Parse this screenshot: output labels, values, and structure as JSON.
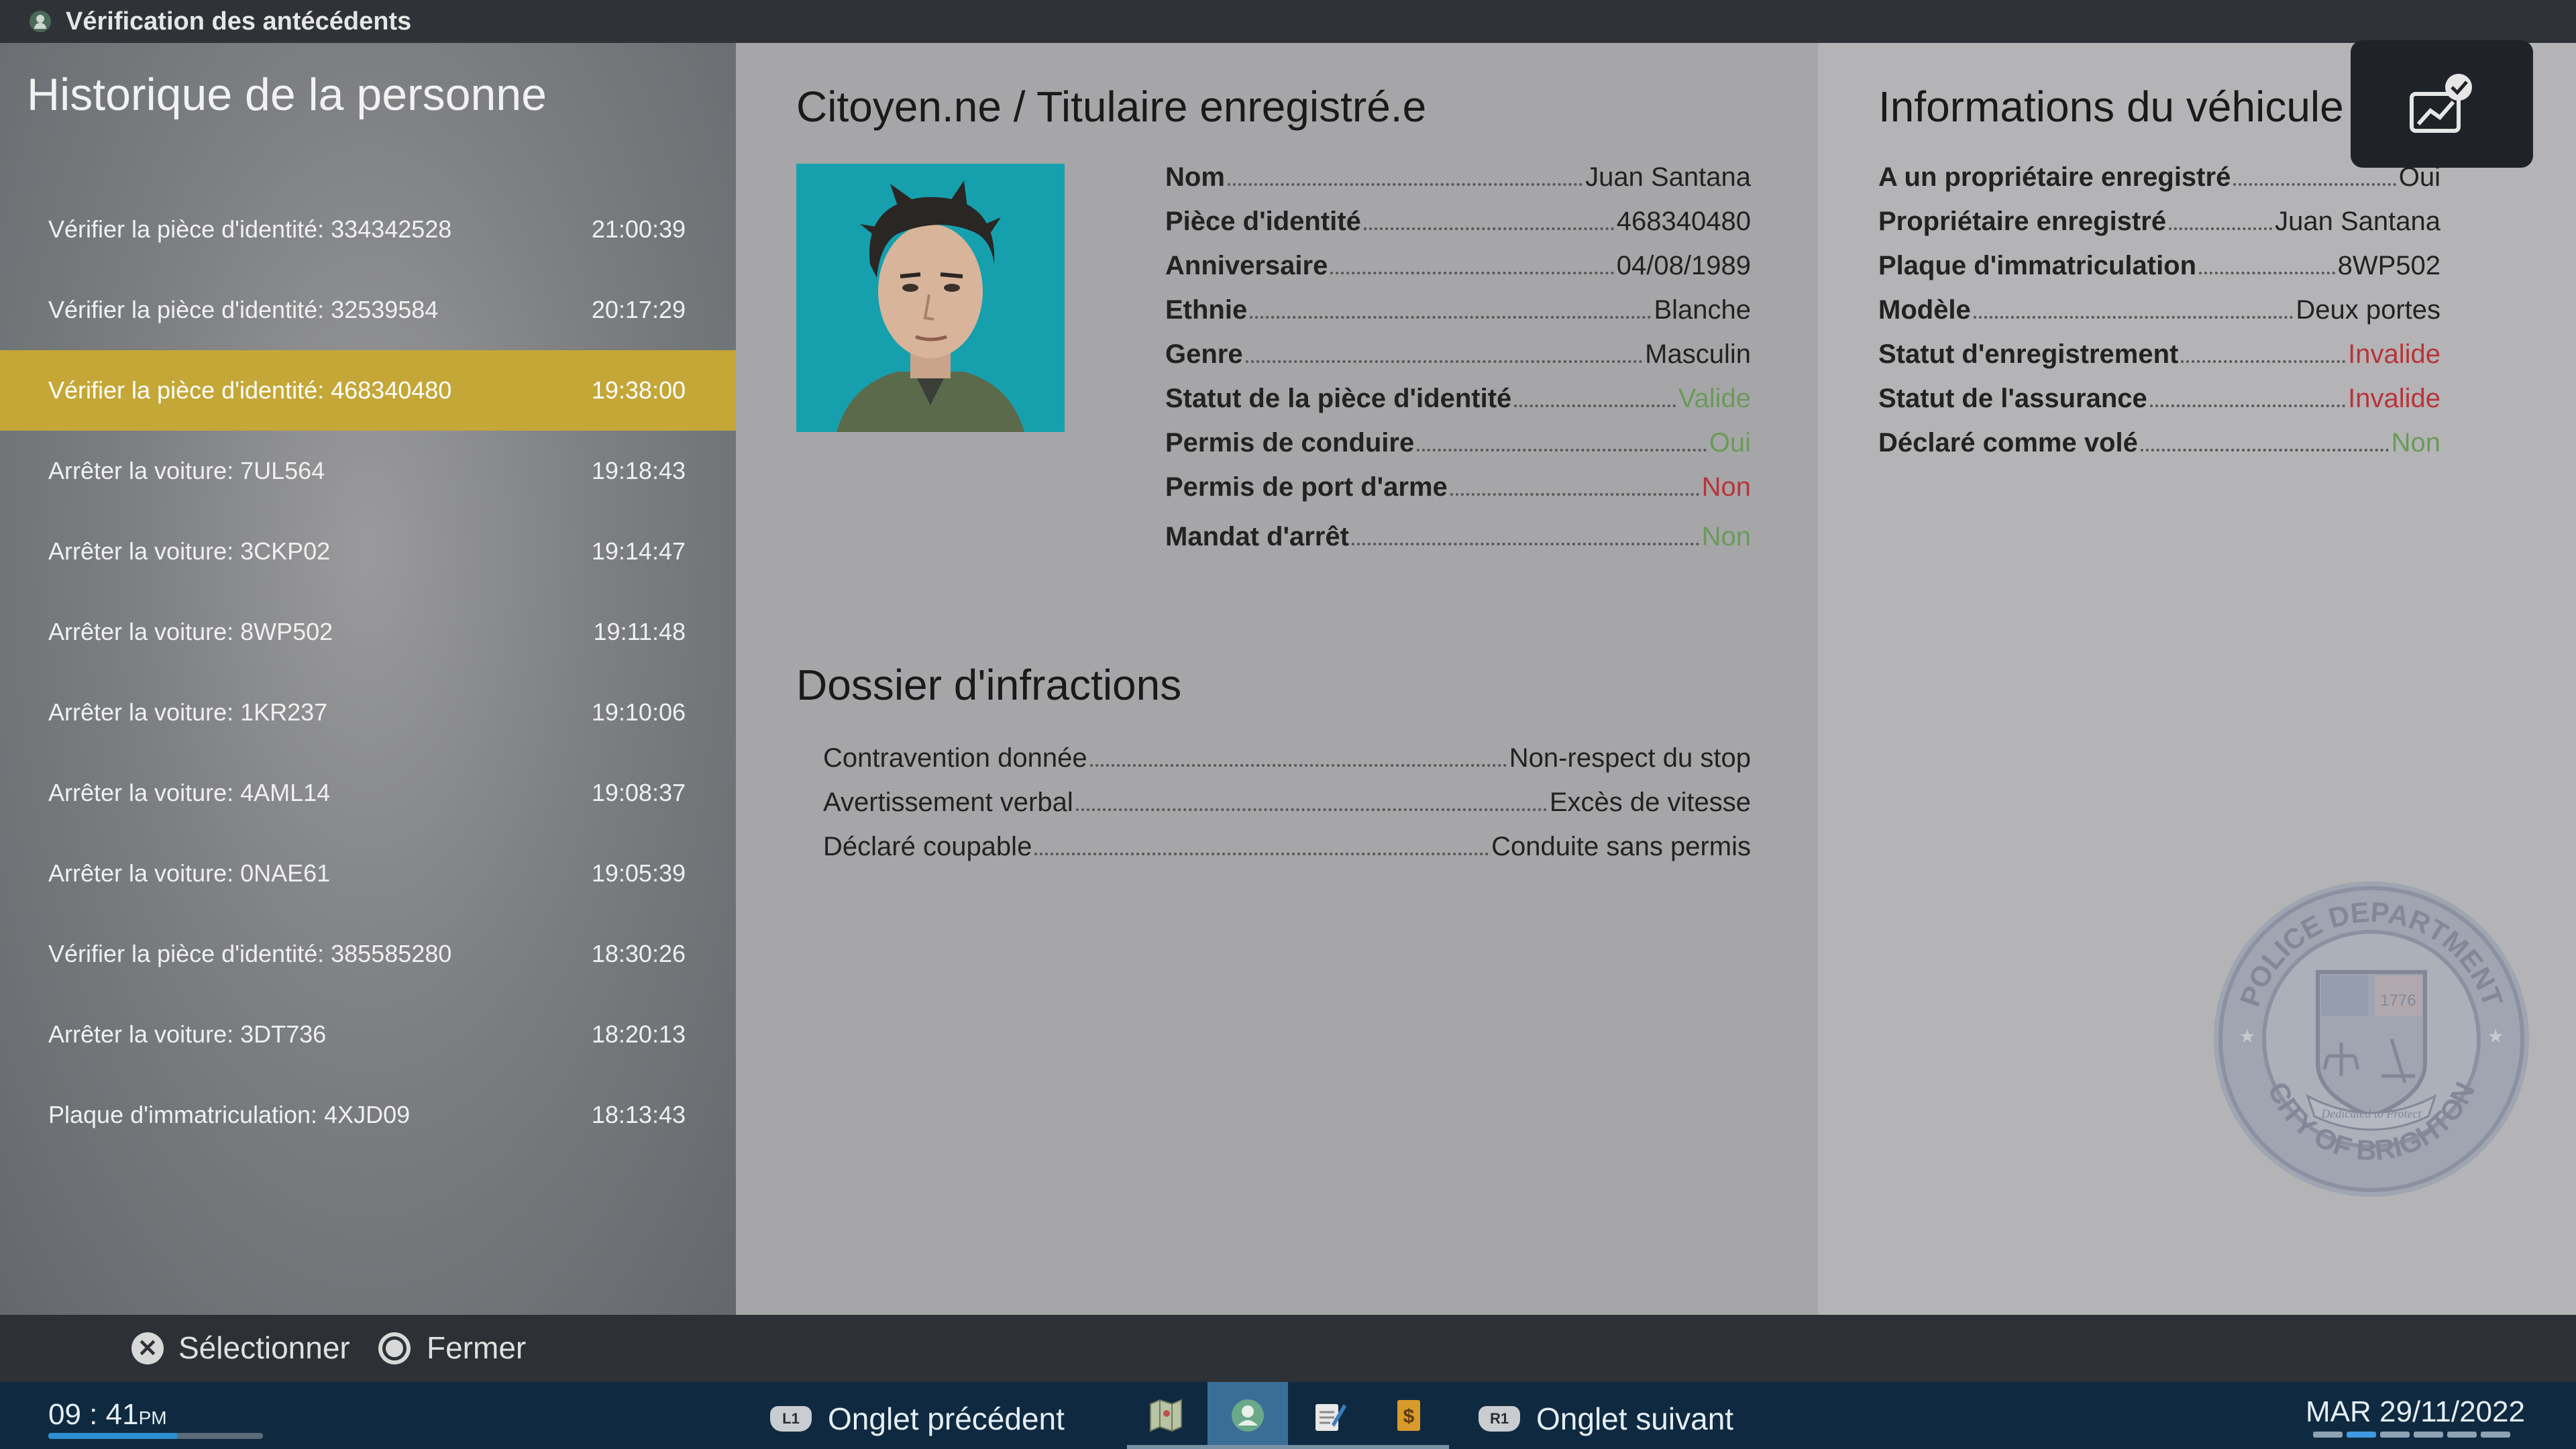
{
  "titlebar": {
    "title": "Vérification des antécédents",
    "icon": "person-check-icon"
  },
  "history": {
    "title": "Historique de la personne",
    "items": [
      {
        "label": "Vérifier la pièce d'identité: 334342528",
        "time": "21:00:39"
      },
      {
        "label": "Vérifier la pièce d'identité: 32539584",
        "time": "20:17:29"
      },
      {
        "label": "Vérifier la pièce d'identité: 468340480",
        "time": "19:38:00"
      },
      {
        "label": "Arrêter la voiture: 7UL564",
        "time": "19:18:43"
      },
      {
        "label": "Arrêter la voiture: 3CKP02",
        "time": "19:14:47"
      },
      {
        "label": "Arrêter la voiture: 8WP502",
        "time": "19:11:48"
      },
      {
        "label": "Arrêter la voiture: 1KR237",
        "time": "19:10:06"
      },
      {
        "label": "Arrêter la voiture: 4AML14",
        "time": "19:08:37"
      },
      {
        "label": "Arrêter la voiture: 0NAE61",
        "time": "19:05:39"
      },
      {
        "label": "Vérifier la pièce d'identité: 385585280",
        "time": "18:30:26"
      },
      {
        "label": "Arrêter la voiture: 3DT736",
        "time": "18:20:13"
      },
      {
        "label": "Plaque d'immatriculation: 4XJD09",
        "time": "18:13:43"
      }
    ],
    "selected_index": 2
  },
  "citizen": {
    "title": "Citoyen.ne / Titulaire enregistré.e",
    "fields": [
      {
        "label": "Nom",
        "value": "Juan Santana",
        "status": "normal"
      },
      {
        "label": "Pièce d'identité",
        "value": "468340480",
        "status": "normal"
      },
      {
        "label": "Anniversaire",
        "value": "04/08/1989",
        "status": "normal"
      },
      {
        "label": "Ethnie",
        "value": "Blanche",
        "status": "normal"
      },
      {
        "label": "Genre",
        "value": "Masculin",
        "status": "normal"
      },
      {
        "label": "Statut de la pièce d'identité",
        "value": "Valide",
        "status": "good"
      },
      {
        "label": "Permis de conduire",
        "value": "Oui",
        "status": "good"
      },
      {
        "label": "Permis de port d'arme",
        "value": "Non",
        "status": "bad"
      },
      {
        "label": "Mandat d'arrêt",
        "value": "Non",
        "status": "good"
      }
    ]
  },
  "offenses": {
    "title": "Dossier d'infractions",
    "rows": [
      {
        "label": "Contravention donnée",
        "value": "Non-respect du stop"
      },
      {
        "label": "Avertissement verbal",
        "value": "Excès de vitesse"
      },
      {
        "label": "Déclaré coupable",
        "value": "Conduite sans permis"
      }
    ]
  },
  "vehicle": {
    "title": "Informations du véhicule",
    "fields": [
      {
        "label": "A un propriétaire enregistré",
        "value": "Oui",
        "status": "normal"
      },
      {
        "label": "Propriétaire enregistré",
        "value": "Juan Santana",
        "status": "normal"
      },
      {
        "label": "Plaque d'immatriculation",
        "value": "8WP502",
        "status": "normal"
      },
      {
        "label": "Modèle",
        "value": "Deux portes",
        "status": "normal"
      },
      {
        "label": "Statut d'enregistrement",
        "value": "Invalide",
        "status": "bad"
      },
      {
        "label": "Statut de l'assurance",
        "value": "Invalide",
        "status": "bad"
      },
      {
        "label": "Déclaré comme volé",
        "value": "Non",
        "status": "good"
      }
    ]
  },
  "seal": {
    "top_text": "POLICE DEPARTMENT",
    "bottom_text": "CITY OF BRIGHTON",
    "motto": "Dedicated to Protect",
    "year": "1776"
  },
  "controls": {
    "select_label": "Sélectionner",
    "close_label": "Fermer",
    "select_icon": "cross-button-icon",
    "close_icon": "circle-button-icon"
  },
  "taskbar": {
    "time": "09 : 41",
    "ampm": "PM",
    "day_progress": 0.6,
    "prev_tab": "Onglet précédent",
    "next_tab": "Onglet suivant",
    "prev_key": "L1",
    "next_key": "R1",
    "date": "MAR 29/11/2022",
    "apps": [
      "map-icon",
      "person-check-icon",
      "clipboard-pen-icon",
      "dollar-ledger-icon"
    ],
    "active_app": 1,
    "page_dots": 6,
    "page_active": 1
  },
  "colors": {
    "accent": "#c4a737",
    "good": "#6a9a5a",
    "bad": "#b8343a",
    "taskbar": "#0f2a40"
  }
}
